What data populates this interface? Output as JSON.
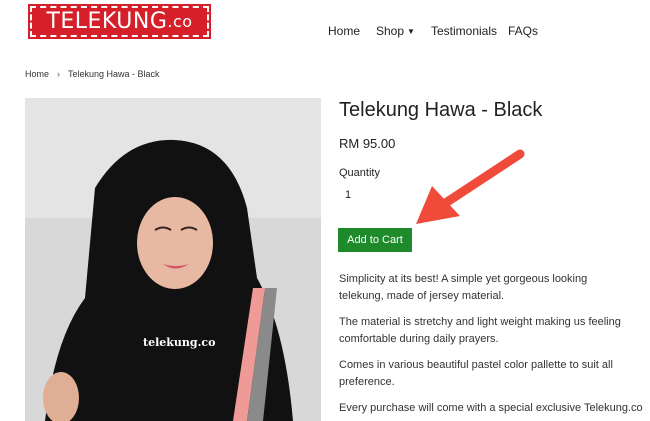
{
  "header": {
    "logo_main": "TELEKUNG",
    "logo_domain": ".co",
    "nav": {
      "home": "Home",
      "shop": "Shop",
      "testimonials": "Testimonials",
      "faqs": "FAQs"
    }
  },
  "breadcrumb": {
    "home": "Home",
    "separator": "›",
    "current": "Telekung Hawa - Black"
  },
  "product": {
    "watermark": "telekung.co",
    "title": "Telekung Hawa - Black",
    "price": "RM 95.00",
    "quantity_label": "Quantity",
    "quantity_value": "1",
    "add_to_cart": "Add to Cart",
    "description": [
      "Simplicity at its best! A simple yet gorgeous looking telekung, made of jersey material.",
      "The material is stretchy and light weight making us feeling comfortable during daily prayers.",
      "Comes in various beautiful pastel color pallette to suit all preference.",
      "Every purchase will come with a special exclusive Telekung.co"
    ]
  },
  "colors": {
    "logo_red": "#d5202a",
    "cart_green": "#1e8a2a",
    "arrow_red": "#f04a3a"
  }
}
